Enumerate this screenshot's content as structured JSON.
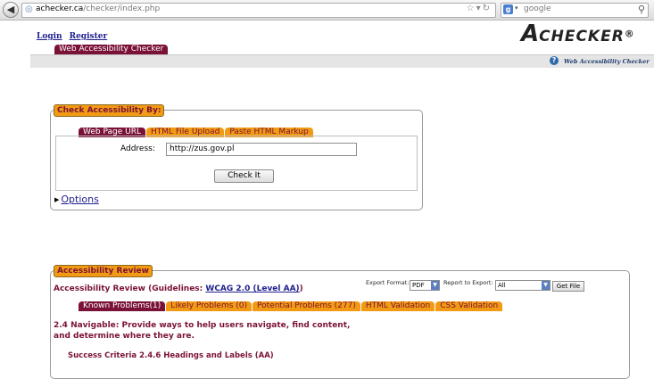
{
  "browser": {
    "url_host": "achecker.ca",
    "url_path": "/checker/index.php",
    "search_query": "google",
    "search_engine_letter": "g"
  },
  "header": {
    "login": "Login",
    "register": "Register",
    "title_tab": "Web Accessibility Checker",
    "logo_big": "A",
    "logo_rest": "CHECKER",
    "logo_mark": "®",
    "help_text": "Web Accessibility Checker"
  },
  "check": {
    "legend": "Check Accessibility By:",
    "tabs": [
      "Web Page URL",
      "HTML File Upload",
      "Paste HTML Markup"
    ],
    "active_tab": 0,
    "address_label": "Address:",
    "address_value": "http://zus.gov.pl",
    "check_button": "Check It",
    "options": "Options"
  },
  "review": {
    "legend": "Accessibility Review",
    "heading_prefix": "Accessibility Review (Guidelines: ",
    "heading_link": "WCAG 2.0 (Level AA)",
    "heading_suffix": ")",
    "export_format_label": "Export Format:",
    "export_format_value": "PDF",
    "report_label": "Report to Export:",
    "report_value": "All",
    "get_file": "Get File",
    "tabs": [
      "Known Problems(1)",
      "Likely Problems (0)",
      "Potential Problems (277)",
      "HTML Validation",
      "CSS Validation"
    ],
    "active_tab": 0,
    "guideline": "2.4 Navigable: Provide ways to help users navigate, find content, and determine where they are.",
    "success_criteria": "Success Criteria 2.4.6 Headings and Labels (AA)"
  },
  "colors": {
    "maroon": "#7a1237",
    "orange": "#f39a14",
    "link": "#1e1f8e"
  }
}
